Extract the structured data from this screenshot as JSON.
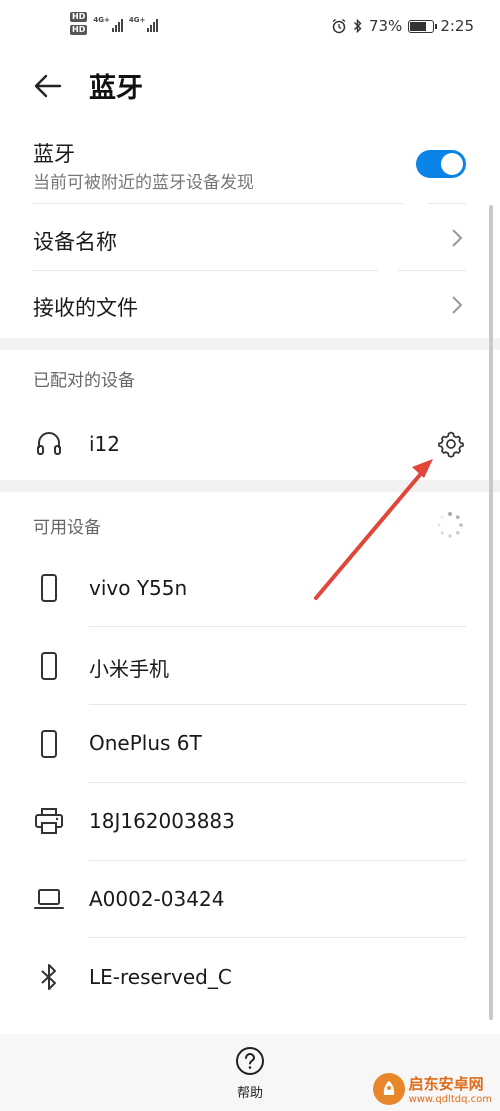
{
  "status_bar": {
    "hd1": "HD",
    "hd2": "HD",
    "net1": "4G+",
    "net2": "4G+",
    "battery_percent": "73%",
    "battery_level": 0.73,
    "time": "2:25"
  },
  "header": {
    "title": "蓝牙"
  },
  "bluetooth": {
    "label": "蓝牙",
    "sublabel": "当前可被附近的蓝牙设备发现",
    "enabled": true
  },
  "settings": {
    "device_name_label": "设备名称",
    "received_files_label": "接收的文件"
  },
  "paired": {
    "title": "已配对的设备",
    "devices": [
      {
        "name": "i12",
        "icon": "headphones-icon"
      }
    ]
  },
  "available": {
    "title": "可用设备",
    "devices": [
      {
        "name": "vivo Y55n",
        "icon": "phone-icon"
      },
      {
        "name": "小米手机",
        "icon": "phone-icon"
      },
      {
        "name": "OnePlus 6T",
        "icon": "phone-icon"
      },
      {
        "name": "18J162003883",
        "icon": "printer-icon"
      },
      {
        "name": "A0002-03424",
        "icon": "laptop-icon"
      },
      {
        "name": "LE-reserved_C",
        "icon": "bluetooth-icon"
      }
    ]
  },
  "bottom": {
    "help_label": "帮助"
  },
  "watermark": {
    "text": "启东安卓网",
    "url": "www.qdltdq.com"
  },
  "colors": {
    "accent": "#0a84e6",
    "arrow": "#e0463a"
  }
}
